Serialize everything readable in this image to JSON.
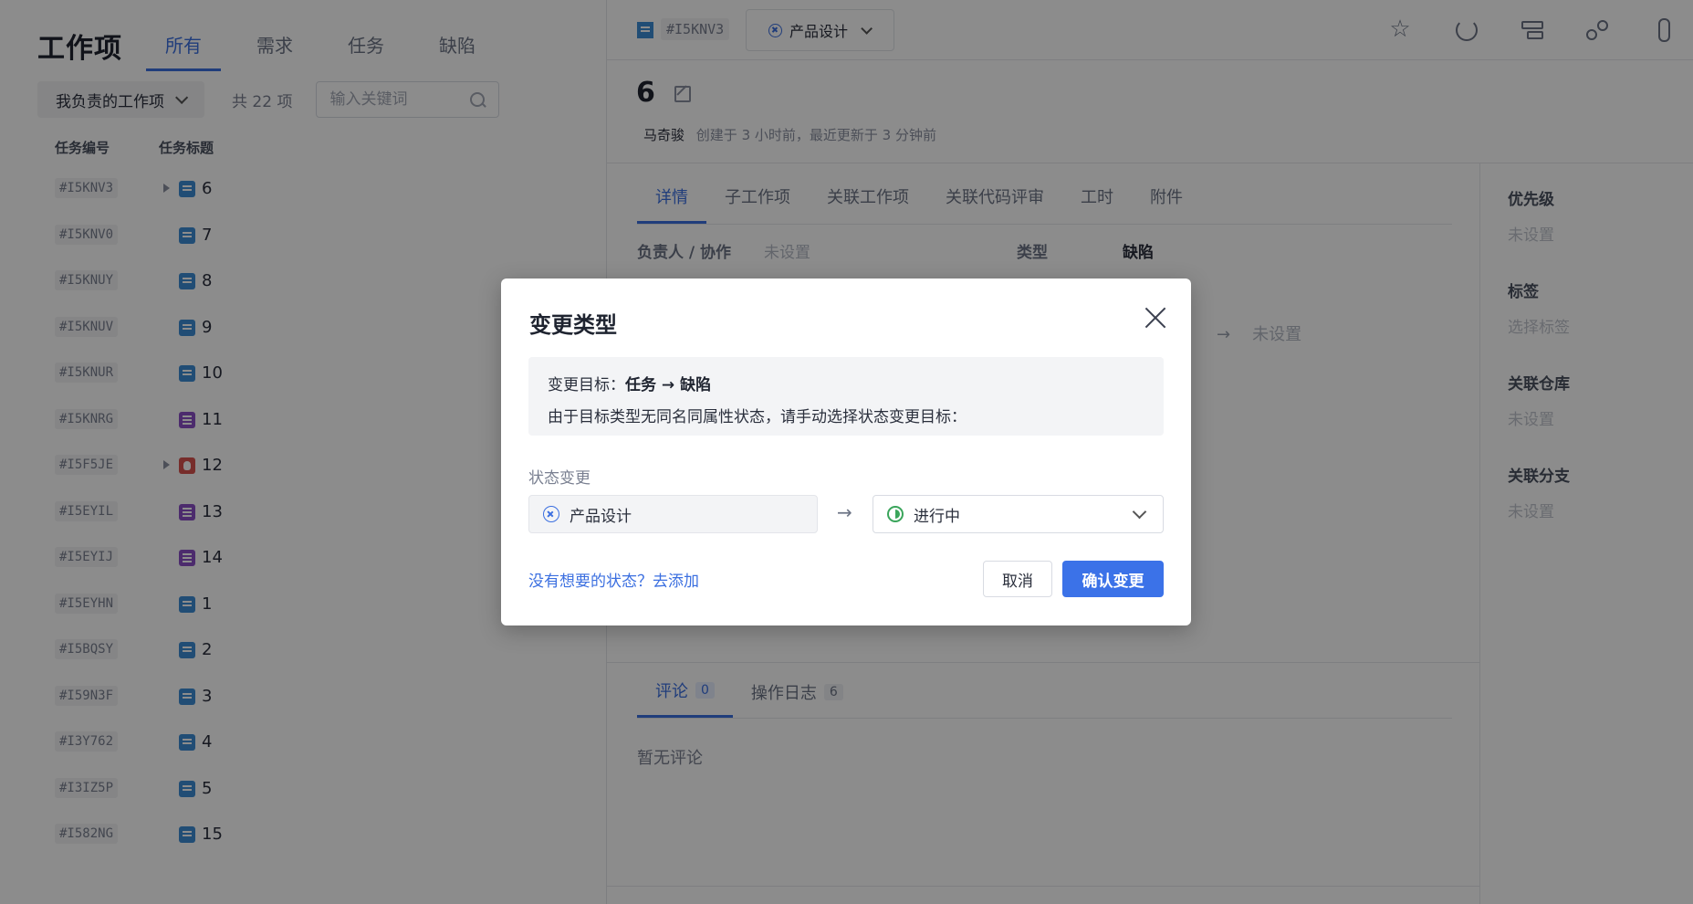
{
  "left": {
    "title": "工作项",
    "tabs": [
      {
        "label": "所有",
        "active": true
      },
      {
        "label": "需求",
        "active": false
      },
      {
        "label": "任务",
        "active": false
      },
      {
        "label": "缺陷",
        "active": false
      }
    ],
    "filter_label": "我负责的工作项",
    "count_text": "共 22 项",
    "search_placeholder": "输入关键词",
    "col_id": "任务编号",
    "col_title": "任务标题",
    "rows": [
      {
        "id": "#I5KNV3",
        "title": "6",
        "type": "task",
        "expandable": true
      },
      {
        "id": "#I5KNV0",
        "title": "7",
        "type": "task",
        "expandable": false
      },
      {
        "id": "#I5KNUY",
        "title": "8",
        "type": "task",
        "expandable": false
      },
      {
        "id": "#I5KNUV",
        "title": "9",
        "type": "task",
        "expandable": false
      },
      {
        "id": "#I5KNUR",
        "title": "10",
        "type": "task",
        "expandable": false
      },
      {
        "id": "#I5KNRG",
        "title": "11",
        "type": "req",
        "expandable": false
      },
      {
        "id": "#I5F5JE",
        "title": "12",
        "type": "bug",
        "expandable": true
      },
      {
        "id": "#I5EYIL",
        "title": "13",
        "type": "req",
        "expandable": false
      },
      {
        "id": "#I5EYIJ",
        "title": "14",
        "type": "req",
        "expandable": false
      },
      {
        "id": "#I5EYHN",
        "title": "1",
        "type": "task",
        "expandable": false
      },
      {
        "id": "#I5BQSY",
        "title": "2",
        "type": "task",
        "expandable": false
      },
      {
        "id": "#I59N3F",
        "title": "3",
        "type": "task",
        "expandable": false
      },
      {
        "id": "#I3Y762",
        "title": "4",
        "type": "task",
        "expandable": false
      },
      {
        "id": "#I3IZ5P",
        "title": "5",
        "type": "task",
        "expandable": false
      },
      {
        "id": "#I582NG",
        "title": "15",
        "type": "task",
        "expandable": false
      }
    ]
  },
  "detail": {
    "id": "#I5KNV3",
    "status": "产品设计",
    "title": "6",
    "author": "马奇骏",
    "meta": "创建于 3 小时前，最近更新于 3 分钟前",
    "tabs": [
      "详情",
      "子工作项",
      "关联工作项",
      "关联代码评审",
      "工时",
      "附件"
    ],
    "field_assignee_label": "负责人 / 协作",
    "field_assignee_value": "未设置",
    "field_type_label": "类型",
    "field_type_value": "缺陷",
    "arrow_unset": "未设置",
    "side": [
      {
        "label": "优先级",
        "value": "未设置"
      },
      {
        "label": "标签",
        "value": "选择标签"
      },
      {
        "label": "关联仓库",
        "value": "未设置"
      },
      {
        "label": "关联分支",
        "value": "未设置"
      }
    ],
    "comment_tab": "评论",
    "comment_count": "0",
    "log_tab": "操作日志",
    "log_count": "6",
    "no_comment": "暂无评论"
  },
  "modal": {
    "title": "变更类型",
    "target_prefix": "变更目标：",
    "target_value": "任务 → 缺陷",
    "hint": "由于目标类型无同名同属性状态，请手动选择状态变更目标：",
    "state_label": "状态变更",
    "from_state": "产品设计",
    "arrow": "→",
    "to_state": "进行中",
    "add_link": "没有想要的状态？去添加",
    "cancel": "取消",
    "confirm": "确认变更"
  },
  "colors": {
    "accent": "#3b6fe0",
    "task_icon": "#3c8dd6",
    "req_icon": "#8a4fc7",
    "bug_icon": "#d9534f",
    "in_progress": "#3aa55b"
  }
}
